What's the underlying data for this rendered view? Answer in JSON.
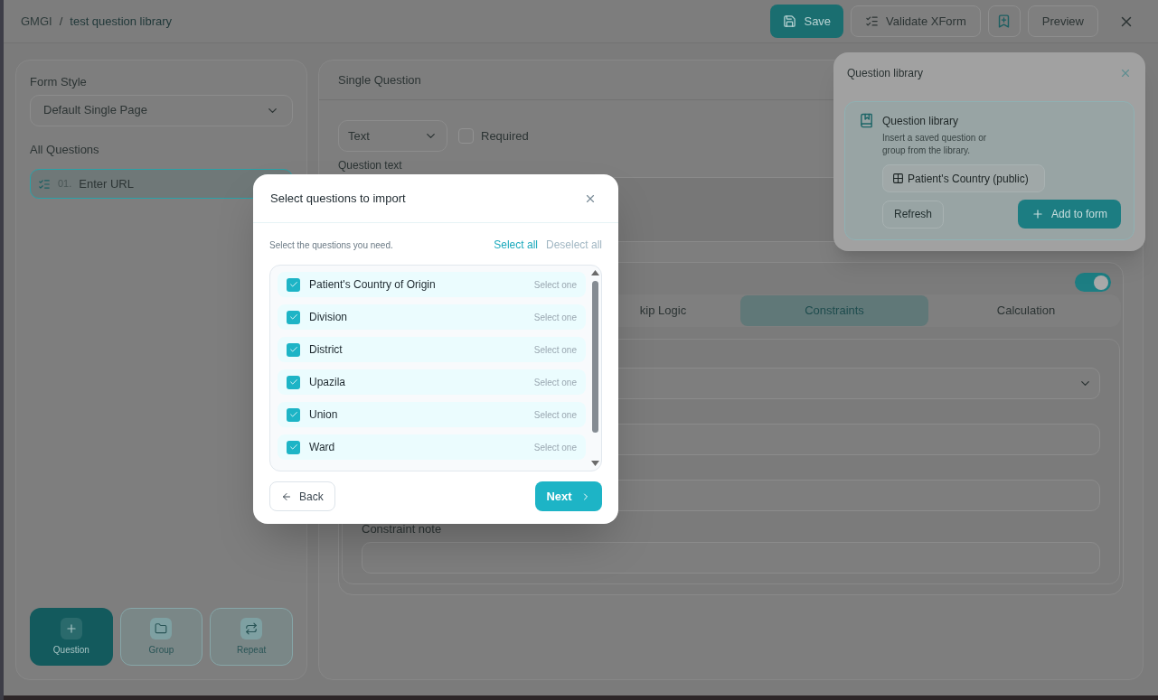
{
  "breadcrumb": {
    "root": "GMGI",
    "separator": "/",
    "current": "test question library"
  },
  "header_actions": [
    {
      "kind": "primary",
      "label": "Save"
    },
    {
      "kind": "secondary",
      "label": "Validate XForm"
    },
    {
      "kind": "icon"
    },
    {
      "kind": "secondary",
      "label": "Preview"
    },
    {
      "kind": "close"
    }
  ],
  "sidebar": {
    "form_style_label": "Form Style",
    "form_style_value": "Default Single Page",
    "questions_label": "All Questions",
    "questions": [
      {
        "number": "01.",
        "label": "Enter URL",
        "selected": true
      }
    ],
    "add_buttons": [
      {
        "kind": "question",
        "label": "Question",
        "selected": true
      },
      {
        "kind": "group",
        "label": "Group",
        "selected": false
      },
      {
        "kind": "repeat",
        "label": "Repeat",
        "selected": false
      }
    ]
  },
  "editor": {
    "title": "Single Question",
    "type_value": "Text",
    "required_label": "Required",
    "required": false,
    "question_text_label": "Question text",
    "enabled": true,
    "tabs": [
      {
        "label": "kip Logic",
        "selected": false
      },
      {
        "label": "Constraints",
        "selected": true
      },
      {
        "label": "Calculation",
        "selected": false
      }
    ],
    "constraint_note_label": "Constraint note"
  },
  "library_panel": {
    "title": "Question library",
    "card_title": "Question library",
    "card_description": "Insert a saved question or group from the library.",
    "select_value": "Patient's Country (public)",
    "refresh_label": "Refresh",
    "add_label": "Add to form"
  },
  "import_dialog": {
    "title": "Select questions to import",
    "hint": "Select the questions you need.",
    "select_all": "Select all",
    "deselect_all": "Deselect all",
    "questions": [
      {
        "label": "Patient's Country of Origin",
        "type": "Select one",
        "checked": true
      },
      {
        "label": "Division",
        "type": "Select one",
        "checked": true
      },
      {
        "label": "District",
        "type": "Select one",
        "checked": true
      },
      {
        "label": "Upazila",
        "type": "Select one",
        "checked": true
      },
      {
        "label": "Union",
        "type": "Select one",
        "checked": true
      },
      {
        "label": "Ward",
        "type": "Select one",
        "checked": true
      }
    ],
    "back_label": "Back",
    "next_label": "Next"
  }
}
